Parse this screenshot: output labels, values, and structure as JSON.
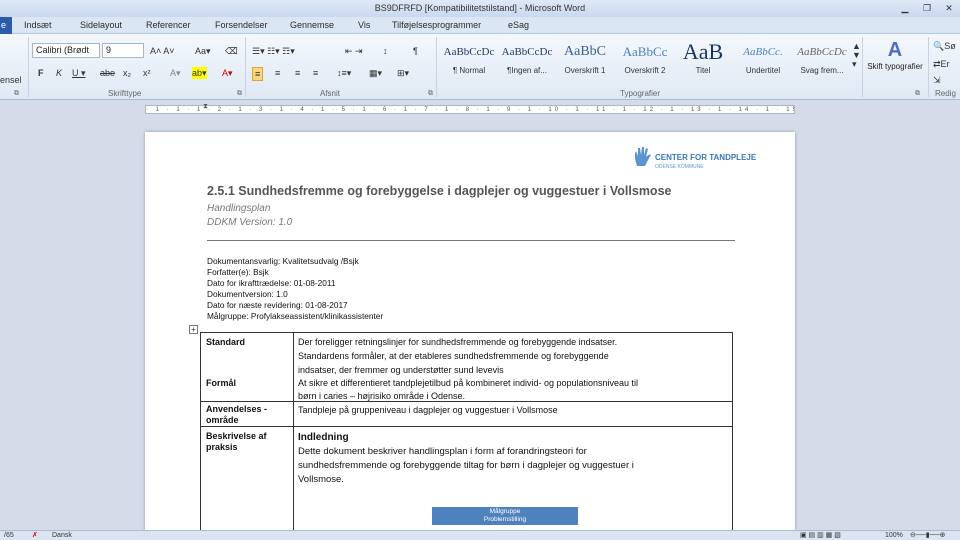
{
  "window": {
    "title": "BS9DFRFD  [Kompatibilitetstilstand]  -  Microsoft Word"
  },
  "tabs": {
    "file": "e",
    "items": [
      "Indsæt",
      "Sidelayout",
      "Referencer",
      "Forsendelser",
      "Gennemse",
      "Vis",
      "Tilføjelsesprogrammer",
      "eSag"
    ]
  },
  "ribbon": {
    "clipboard_label": "ensel",
    "font_name": "Calibri (Brødt",
    "font_size": "9",
    "group_font": "Skrifttype",
    "group_paragraph": "Afsnit",
    "group_styles": "Typografier",
    "group_edit": "Redig",
    "styles": [
      {
        "preview": "AaBbCcDc",
        "label": "¶ Normal"
      },
      {
        "preview": "AaBbCcDc",
        "label": "¶Ingen af..."
      },
      {
        "preview": "AaBbC",
        "label": "Overskrift 1"
      },
      {
        "preview": "AaBbCc",
        "label": "Overskrift 2"
      },
      {
        "preview": "AaB",
        "label": "Titel"
      },
      {
        "preview": "AaBbCc.",
        "label": "Undertitel"
      },
      {
        "preview": "AaBbCcDc",
        "label": "Svag frem..."
      }
    ],
    "change_styles": "Skift typografier",
    "search": "Sø",
    "replace": "Er"
  },
  "document": {
    "logo_text": "CENTER FOR TANDPLEJE",
    "logo_sub": "ODENSE KOMMUNE",
    "title": "2.5.1 Sundhedsfremme og forebyggelse i dagplejer og vuggestuer i Vollsmose",
    "subtitle1": "Handlingsplan",
    "subtitle2": "DDKM Version: 1.0",
    "meta": [
      "Dokumentansvarlig: Kvalitetsudvalg /Bsjk",
      "Forfatter(e): Bsjk",
      "Dato for ikrafttrædelse: 01-08-2011",
      "Dokumentversion: 1.0",
      "Dato for næste revidering: 01-08-2017",
      "Målgruppe: Profylakseassistent/klinikassistenter"
    ],
    "table": {
      "standard_label": "Standard",
      "standard_text": [
        "Der foreligger retningslinjer for sundhedsfremmende og forebyggende indsatser.",
        "Standardens formåler, at der etableres sundhedsfremmende og forebyggende",
        "indsatser, der fremmer og understøtter sund levevis"
      ],
      "formaal_label": "Formål",
      "formaal_text": [
        "At sikre et differentieret tandplejetilbud på kombineret individ- og populationsniveau til",
        "børn i caries – højrisiko område i Odense."
      ],
      "anvendelse_label": [
        "Anvendelses -",
        "område"
      ],
      "anvendelse_text": "Tandpleje på gruppeniveau i dagplejer og vuggestuer i Vollsmose",
      "beskrivelse_label": [
        "Beskrivelse af",
        "praksis"
      ],
      "indledning_head": "Indledning",
      "indledning_text": [
        "Dette dokument beskriver handlingsplan i form af forandringsteori for",
        "sundhedsfremmende og forebyggende tiltag for børn i dagplejer og vuggestuer i",
        "Vollsmose."
      ],
      "flow_box": [
        "Målgruppe",
        "Problemstilling"
      ]
    }
  },
  "status": {
    "page": "/65",
    "language": "Dansk",
    "zoom": "100%"
  }
}
